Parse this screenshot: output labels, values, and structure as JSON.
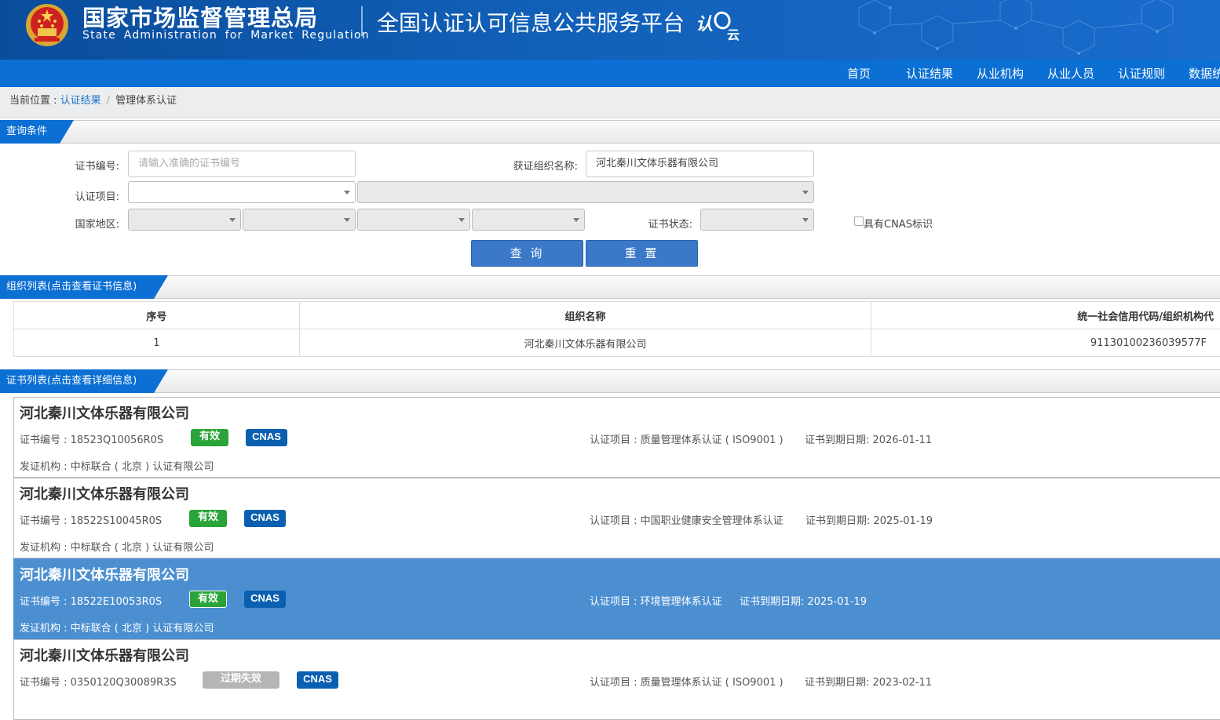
{
  "header": {
    "org_cn": "国家市场监督管理总局",
    "org_en": "State Administration for Market Regulation",
    "platform": "全国认证认可信息公共服务平台",
    "logo_text": "认e云"
  },
  "nav": [
    "首页",
    "认证结果",
    "从业机构",
    "从业人员",
    "认证规则",
    "数据统"
  ],
  "breadcrumb": {
    "label": "当前位置 : ",
    "link": "认证结果",
    "sep": "/",
    "current": "管理体系认证"
  },
  "query": {
    "title": "查询条件",
    "cert_no_label": "证书编号:",
    "cert_no_placeholder": "请输入准确的证书编号",
    "org_name_label": "获证组织名称:",
    "org_name_value": "河北秦川文体乐器有限公司",
    "project_label": "认证项目:",
    "region_label": "国家地区:",
    "status_label": "证书状态:",
    "cnas_label": "具有CNAS标识",
    "search_button": "查 询",
    "reset_button": "重 置"
  },
  "org_list": {
    "title": "组织列表(点击查看证书信息)",
    "columns": [
      "序号",
      "组织名称",
      "统一社会信用代码/组织机构代"
    ],
    "rows": [
      [
        "1",
        "河北秦川文体乐器有限公司",
        "91130100236039577F"
      ]
    ]
  },
  "cert_list": {
    "title": "证书列表(点击查看详细信息)",
    "items": [
      {
        "org": "河北秦川文体乐器有限公司",
        "cert_no": "证书编号 : 18523Q10056R0S",
        "status": "有效",
        "cnas": "CNAS",
        "issuer": "发证机构 : 中标联合 ( 北京 ) 认证有限公司",
        "project": "认证项目 : 质量管理体系认证 ( ISO9001 )",
        "expiry": "证书到期日期: 2026-01-11"
      },
      {
        "org": "河北秦川文体乐器有限公司",
        "cert_no": "证书编号 : 18522S10045R0S",
        "status": "有效",
        "cnas": "CNAS",
        "issuer": "发证机构 : 中标联合 ( 北京 ) 认证有限公司",
        "project": "认证项目 : 中国职业健康安全管理体系认证",
        "expiry": "证书到期日期: 2025-01-19"
      },
      {
        "org": "河北秦川文体乐器有限公司",
        "cert_no": "证书编号 : 18522E10053R0S",
        "status": "有效",
        "cnas": "CNAS",
        "issuer": "发证机构 : 中标联合 ( 北京 ) 认证有限公司",
        "project": "认证项目 : 环境管理体系认证",
        "expiry": "证书到期日期: 2025-01-19"
      },
      {
        "org": "河北秦川文体乐器有限公司",
        "cert_no": "证书编号 : 0350120Q30089R3S",
        "status": "过期失效",
        "cnas": "CNAS",
        "issuer": "",
        "project": "认证项目 : 质量管理体系认证 ( ISO9001 )",
        "expiry": "证书到期日期: 2023-02-11"
      }
    ]
  },
  "colors": {
    "header": "#1160b8",
    "nav": "#0b6fd3",
    "button": "#3b78c8",
    "valid": "#2aa43a",
    "expired": "#b5b5b5",
    "cnas": "#0b5fb0",
    "selected_row": "#4b8fd1"
  }
}
